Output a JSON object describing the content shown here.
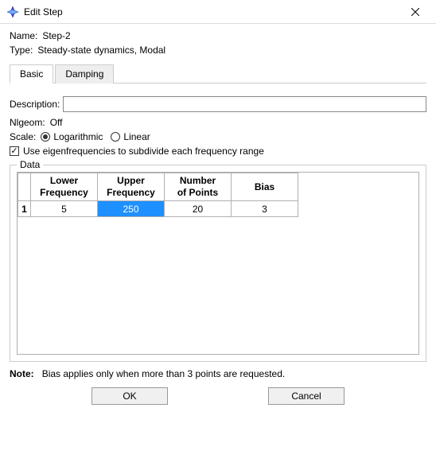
{
  "window": {
    "title": "Edit Step"
  },
  "info": {
    "name_label": "Name:",
    "name_value": "Step-2",
    "type_label": "Type:",
    "type_value": "Steady-state dynamics, Modal"
  },
  "tabs": {
    "basic": "Basic",
    "damping": "Damping"
  },
  "basic": {
    "description_label": "Description:",
    "description_value": "",
    "nlgeom_label": "Nlgeom:",
    "nlgeom_value": "Off",
    "scale_label": "Scale:",
    "scale_logarithmic": "Logarithmic",
    "scale_linear": "Linear",
    "use_eigen_label": "Use eigenfrequencies to subdivide each frequency range",
    "data_legend": "Data",
    "headers": {
      "lower": "Lower\nFrequency",
      "upper": "Upper\nFrequency",
      "points": "Number\nof Points",
      "bias": "Bias"
    },
    "rows": [
      {
        "num": "1",
        "lower": "5",
        "upper": "250",
        "points": "20",
        "bias": "3"
      }
    ],
    "note_prefix": "Note:",
    "note_text": "Bias applies only when more than 3 points are requested."
  },
  "footer": {
    "ok": "OK",
    "cancel": "Cancel"
  }
}
